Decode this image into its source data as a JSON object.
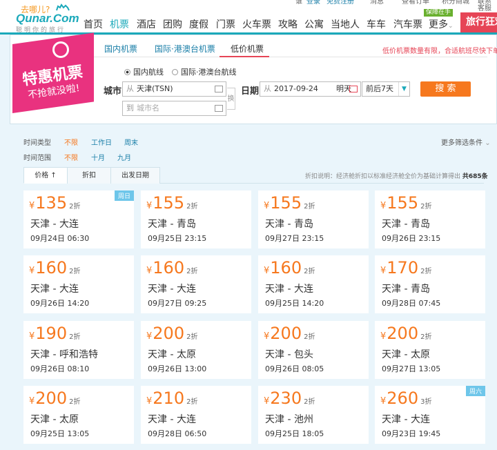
{
  "topbar": {
    "items": [
      "谁",
      "登录",
      "免费注册",
      "消息",
      "查看订单",
      "积分商城",
      "联系客服"
    ]
  },
  "logo": {
    "slogan": "去哪儿?",
    "brand": "Qunar.Com",
    "tagline": "聪明你的旅行"
  },
  "nav": {
    "items": [
      "首页",
      "机票",
      "酒店",
      "团购",
      "度假",
      "门票",
      "火车票",
      "攻略",
      "公寓",
      "当地人",
      "车车",
      "汽车票",
      "更多"
    ],
    "active": "机票",
    "badge": "保障在手",
    "promo": "旅行狂欢"
  },
  "ribbon": {
    "title": "特惠机票",
    "subtitle": "不抢就没啦!"
  },
  "tabs": [
    "国内机票",
    "国际·港澳台机票",
    "低价机票"
  ],
  "notice": "低价机票数量有限，合适航班尽快下单!",
  "search": {
    "route_domestic": "国内航线",
    "route_intl": "国际·港澳台航线",
    "city_label": "城市",
    "from_prefix": "从",
    "from_value": "天津(TSN)",
    "to_prefix": "到",
    "to_placeholder": "城市名",
    "swap_label": "换",
    "date_label": "日期",
    "date_prefix": "从",
    "date_value": "2017-09-24",
    "date_hint": "明天",
    "range_value": "前后7天",
    "button": "搜 索"
  },
  "filters": {
    "type_label": "时间类型",
    "type_options": [
      "不限",
      "工作日",
      "周末"
    ],
    "range_label": "时间范围",
    "range_options": [
      "不限",
      "十月",
      "九月"
    ],
    "more": "更多筛选条件"
  },
  "sort": {
    "tabs": [
      "价格 ↑",
      "折扣",
      "出发日期"
    ],
    "note": "折扣说明：经济舱折扣以标准经济舱全价为基础计算得出",
    "total": "共685条"
  },
  "currency": "¥",
  "flights": [
    {
      "price": "135",
      "discount": "2折",
      "route": "天津 - 大连",
      "time": "09月24日 06:30",
      "tag": "周日"
    },
    {
      "price": "155",
      "discount": "2折",
      "route": "天津 - 青岛",
      "time": "09月25日 23:15",
      "tag": ""
    },
    {
      "price": "155",
      "discount": "2折",
      "route": "天津 - 青岛",
      "time": "09月27日 23:15",
      "tag": ""
    },
    {
      "price": "155",
      "discount": "2折",
      "route": "天津 - 青岛",
      "time": "09月26日 23:15",
      "tag": ""
    },
    {
      "price": "160",
      "discount": "2折",
      "route": "天津 - 大连",
      "time": "09月26日 14:20",
      "tag": ""
    },
    {
      "price": "160",
      "discount": "2折",
      "route": "天津 - 大连",
      "time": "09月27日 09:25",
      "tag": ""
    },
    {
      "price": "160",
      "discount": "2折",
      "route": "天津 - 大连",
      "time": "09月25日 14:20",
      "tag": ""
    },
    {
      "price": "170",
      "discount": "2折",
      "route": "天津 - 青岛",
      "time": "09月28日 07:45",
      "tag": ""
    },
    {
      "price": "190",
      "discount": "2折",
      "route": "天津 - 呼和浩特",
      "time": "09月26日 08:10",
      "tag": ""
    },
    {
      "price": "200",
      "discount": "2折",
      "route": "天津 - 太原",
      "time": "09月26日 13:00",
      "tag": ""
    },
    {
      "price": "200",
      "discount": "2折",
      "route": "天津 - 包头",
      "time": "09月26日 08:05",
      "tag": ""
    },
    {
      "price": "200",
      "discount": "2折",
      "route": "天津 - 太原",
      "time": "09月27日 13:05",
      "tag": ""
    },
    {
      "price": "200",
      "discount": "2折",
      "route": "天津 - 太原",
      "time": "09月25日 13:05",
      "tag": ""
    },
    {
      "price": "210",
      "discount": "2折",
      "route": "天津 - 大连",
      "time": "09月28日 06:50",
      "tag": ""
    },
    {
      "price": "230",
      "discount": "2折",
      "route": "天津 - 池州",
      "time": "09月25日 18:05",
      "tag": ""
    },
    {
      "price": "260",
      "discount": "3折",
      "route": "天津 - 大连",
      "time": "09月23日 19:45",
      "tag": "周六"
    }
  ]
}
